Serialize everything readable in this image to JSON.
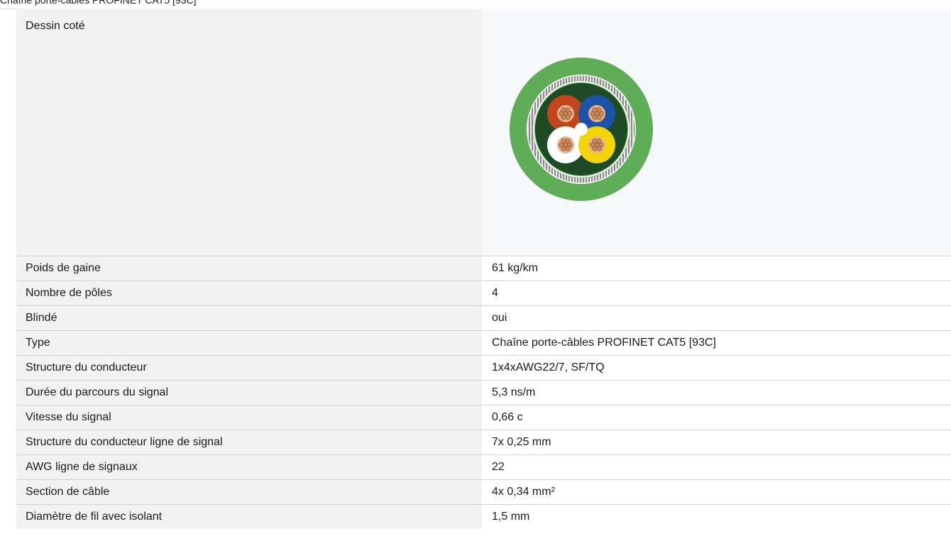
{
  "header_fragment": "Chaîne porte-câbles PROFINET CAT5 [93C]",
  "drawing": {
    "label": "Dessin coté",
    "image": "cable-cross-section-image",
    "colors": {
      "jacket": "#5fae57",
      "inner": "#1e4a25",
      "core_red": "#c2461c",
      "core_blue": "#1c53a8",
      "core_white": "#ffffff",
      "core_yellow": "#f2d40b",
      "copper": "#c98a5a"
    }
  },
  "rows": [
    {
      "label": "Poids de gaine",
      "value": "61 kg/km"
    },
    {
      "label": "Nombre de pôles",
      "value": "4"
    },
    {
      "label": "Blindé",
      "value": "oui"
    },
    {
      "label": "Type",
      "value": "Chaîne porte-câbles PROFINET CAT5 [93C]"
    },
    {
      "label": "Structure du conducteur",
      "value": "1x4xAWG22/7, SF/TQ"
    },
    {
      "label": "Durée du parcours du signal",
      "value": "5,3 ns/m"
    },
    {
      "label": "Vitesse du signal",
      "value": "0,66 c"
    },
    {
      "label": "Structure du conducteur ligne de signal",
      "value": "7x 0,25 mm"
    },
    {
      "label": "AWG ligne de signaux",
      "value": "22"
    },
    {
      "label": "Section de câble",
      "value": "4x 0,34 mm²"
    },
    {
      "label": "Diamètre de fil avec isolant",
      "value": "1,5 mm"
    }
  ]
}
